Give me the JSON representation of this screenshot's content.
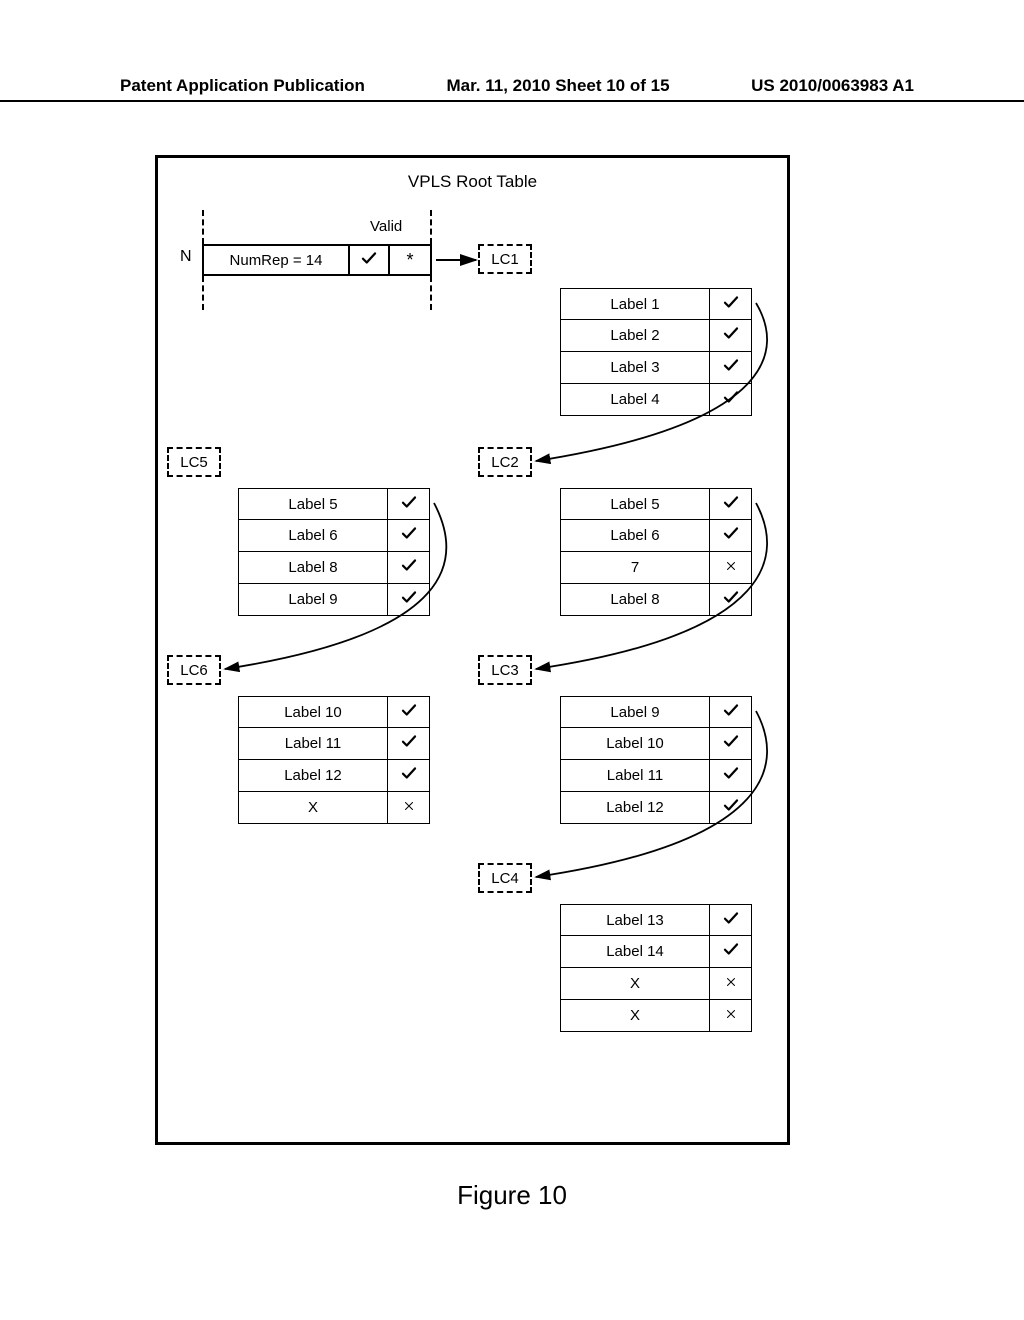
{
  "header": {
    "left": "Patent Application Publication",
    "mid": "Mar. 11, 2010  Sheet 10 of 15",
    "right": "US 2010/0063983 A1"
  },
  "diagram": {
    "title": "VPLS Root Table",
    "n_label": "N",
    "valid_label": "Valid",
    "root": {
      "numrep": "NumRep = 14",
      "valid": "check",
      "ptr": "*"
    },
    "lc_boxes": [
      "LC1",
      "LC2",
      "LC3",
      "LC4",
      "LC5",
      "LC6"
    ],
    "tables": {
      "LC1": [
        {
          "label": "Label 1",
          "mark": "check"
        },
        {
          "label": "Label 2",
          "mark": "check"
        },
        {
          "label": "Label 3",
          "mark": "check"
        },
        {
          "label": "Label 4",
          "mark": "check"
        }
      ],
      "LC2": [
        {
          "label": "Label 5",
          "mark": "check"
        },
        {
          "label": "Label 6",
          "mark": "check"
        },
        {
          "label": "7",
          "mark": "smallcross"
        },
        {
          "label": "Label 8",
          "mark": "check"
        }
      ],
      "LC3": [
        {
          "label": "Label 9",
          "mark": "check"
        },
        {
          "label": "Label 10",
          "mark": "check"
        },
        {
          "label": "Label 11",
          "mark": "check"
        },
        {
          "label": "Label 12",
          "mark": "check"
        }
      ],
      "LC4": [
        {
          "label": "Label 13",
          "mark": "check"
        },
        {
          "label": "Label 14",
          "mark": "check"
        },
        {
          "label": "X",
          "mark": "smallcross"
        },
        {
          "label": "X",
          "mark": "smallcross"
        }
      ],
      "LC5": [
        {
          "label": "Label 5",
          "mark": "check"
        },
        {
          "label": "Label 6",
          "mark": "check"
        },
        {
          "label": "Label 8",
          "mark": "check"
        },
        {
          "label": "Label 9",
          "mark": "check"
        }
      ],
      "LC6": [
        {
          "label": "Label 10",
          "mark": "check"
        },
        {
          "label": "Label 11",
          "mark": "check"
        },
        {
          "label": "Label 12",
          "mark": "check"
        },
        {
          "label": "X",
          "mark": "smallcross"
        }
      ]
    }
  },
  "caption": "Figure 10"
}
